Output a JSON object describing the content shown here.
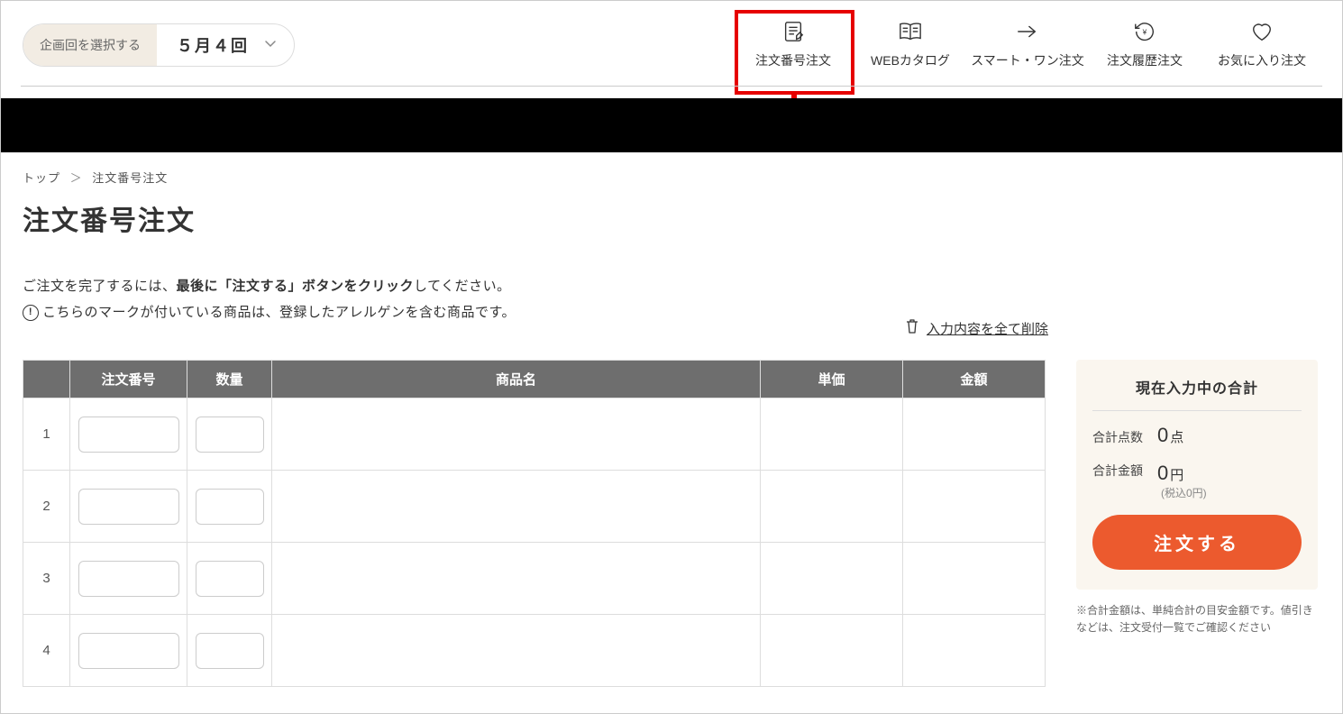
{
  "plan_selector": {
    "label": "企画回を選択する",
    "value": "５月４回"
  },
  "nav": [
    {
      "key": "order-by-number",
      "label": "注文番号注文"
    },
    {
      "key": "web-catalog",
      "label": "WEBカタログ"
    },
    {
      "key": "smart-one",
      "label": "スマート・ワン注文"
    },
    {
      "key": "order-history",
      "label": "注文履歴注文"
    },
    {
      "key": "favorites",
      "label": "お気に入り注文"
    }
  ],
  "breadcrumb": {
    "top": "トップ",
    "current": "注文番号注文"
  },
  "page_title": "注文番号注文",
  "instructions": {
    "line1_pre": "ご注文を完了するには、",
    "line1_bold": "最後に「注文する」ボタンをクリック",
    "line1_post": "してください。",
    "line2": "こちらのマークが付いている商品は、登録したアレルゲンを含む商品です。"
  },
  "delete_all_label": "入力内容を全て削除",
  "table": {
    "headers": {
      "order_no": "注文番号",
      "qty": "数量",
      "name": "商品名",
      "unit_price": "単価",
      "amount": "金額"
    },
    "rows": [
      {
        "idx": "1",
        "order_no": "",
        "qty": ""
      },
      {
        "idx": "2",
        "order_no": "",
        "qty": ""
      },
      {
        "idx": "3",
        "order_no": "",
        "qty": ""
      },
      {
        "idx": "4",
        "order_no": "",
        "qty": ""
      }
    ]
  },
  "summary": {
    "title": "現在入力中の合計",
    "count_label": "合計点数",
    "count_value": "0",
    "count_unit": "点",
    "amount_label": "合計金額",
    "amount_value": "0",
    "amount_unit": "円",
    "amount_sub": "(税込0円)",
    "button": "注文する",
    "note": "※合計金額は、単純合計の目安金額です。値引きなどは、注文受付一覧でご確認ください"
  }
}
